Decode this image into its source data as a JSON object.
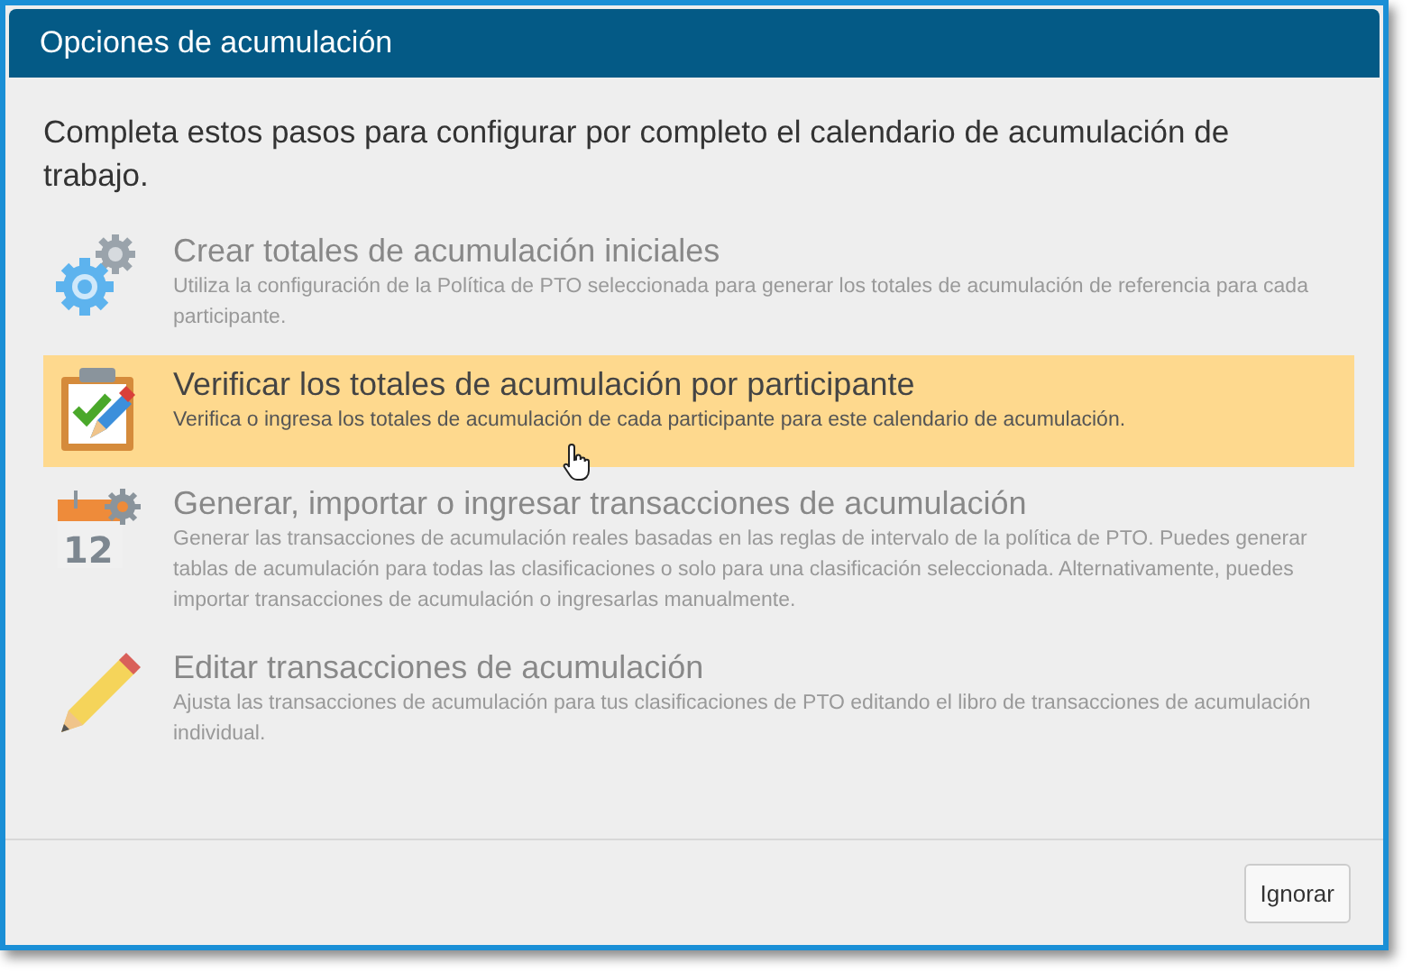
{
  "window": {
    "title": "Opciones de acumulación"
  },
  "intro": "Completa estos pasos para configurar por completo el calendario de acumulación de trabajo.",
  "steps": [
    {
      "kind": "gears",
      "title": "Crear totales de acumulación iniciales",
      "description": "Utiliza la configuración de la Política de PTO seleccionada para generar los totales de acumulación de referencia para cada participante.",
      "selected": false
    },
    {
      "kind": "clipboard",
      "title": "Verificar los totales de acumulación por participante",
      "description": "Verifica o ingresa los totales de acumulación de cada participante para este calendario de acumulación.",
      "selected": true
    },
    {
      "kind": "calendar",
      "icon_text": "12",
      "title": "Generar, importar o ingresar transacciones de acumulación",
      "description": "Generar las transacciones de acumulación reales basadas en las reglas de intervalo de la política de PTO. Puedes generar tablas de acumulación para todas las clasificaciones o solo para una clasificación seleccionada. Alternativamente, puedes importar transacciones de acumulación o ingresarlas manualmente.",
      "selected": false
    },
    {
      "kind": "pencil",
      "title": "Editar transacciones de acumulación",
      "description": "Ajusta las transacciones de acumulación para tus clasificaciones de PTO editando el libro de transacciones de acumulación individual.",
      "selected": false
    }
  ],
  "buttons": [
    "Ignorar"
  ]
}
